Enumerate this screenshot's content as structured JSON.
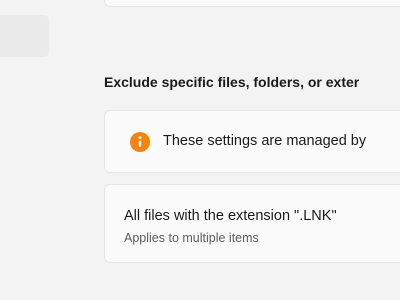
{
  "section": {
    "title": "Exclude specific files, folders, or exter"
  },
  "notice": {
    "icon": "info-icon",
    "icon_color": "#f7830f",
    "text": "These settings are managed by"
  },
  "exclusion_item": {
    "title": "All files with the extension \".LNK\"",
    "subtitle": "Applies to multiple items"
  }
}
